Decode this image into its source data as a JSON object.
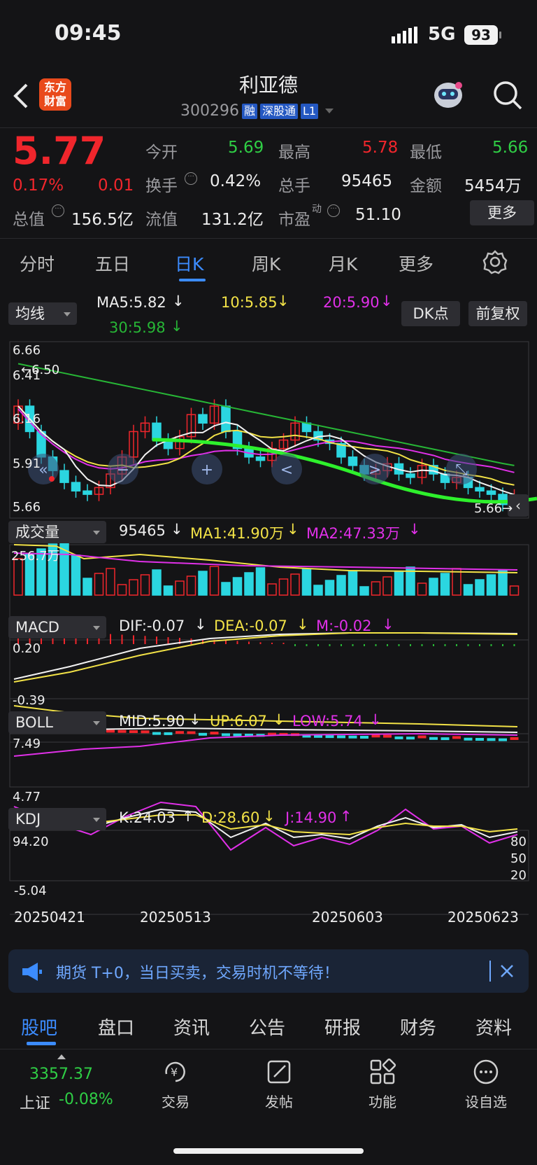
{
  "status": {
    "time": "09:45",
    "network": "5G",
    "battery": "93"
  },
  "header": {
    "title": "利亚德",
    "code": "300296",
    "badges": [
      "融",
      "深股通",
      "L1"
    ]
  },
  "quote": {
    "price": "5.77",
    "pct": "0.17%",
    "change": "0.01",
    "open_label": "今开",
    "open": "5.69",
    "high_label": "最高",
    "high": "5.78",
    "low_label": "最低",
    "low": "5.66",
    "turnover_label": "换手",
    "turnover": "0.42%",
    "volume_label": "总手",
    "volume": "95465",
    "amount_label": "金额",
    "amount": "5454万",
    "mcap_label": "总值",
    "mcap": "156.5亿",
    "float_label": "流值",
    "float": "131.2亿",
    "pe_label": "市盈",
    "pe_sup": "动",
    "pe": "51.10",
    "more": "更多"
  },
  "period_tabs": [
    "分时",
    "五日",
    "日K",
    "周K",
    "月K",
    "更多"
  ],
  "ma": {
    "selector": "均线",
    "ma5": "MA5:5.82",
    "ma10": "10:5.85",
    "ma20": "20:5.90",
    "ma30": "30:5.98",
    "dk": "DK点",
    "adj": "前复权"
  },
  "kline": {
    "y_labels": [
      "6.66",
      "6.41",
      "6.16",
      "5.91",
      "5.66"
    ],
    "high_mark": "6.50",
    "low_mark": "5.66",
    "colors": {
      "up": "#f0262c",
      "down": "#2bd6e0",
      "ma5": "#f2f2f2",
      "ma10": "#f2e247",
      "ma20": "#e030e8",
      "ma30": "#27b636"
    }
  },
  "volume": {
    "selector": "成交量",
    "value": "95465",
    "ma1": "MA1:41.90万",
    "ma2": "MA2:47.33万",
    "max": "256.7万"
  },
  "macd": {
    "selector": "MACD",
    "dif": "DIF:-0.07",
    "dea": "DEA:-0.07",
    "m": "M:-0.02",
    "top": "0.20",
    "bottom": "-0.39"
  },
  "boll": {
    "selector": "BOLL",
    "mid": "MID:5.90",
    "up": "UP:6.07",
    "low": "LOW:5.74",
    "top": "7.49",
    "bottom": "4.77"
  },
  "kdj": {
    "selector": "KDJ",
    "k": "K:24.03",
    "d": "D:28.60",
    "j": "J:14.90",
    "top": "94.20",
    "bottom": "-5.04",
    "r80": "80",
    "r50": "50",
    "r20": "20"
  },
  "dates": [
    "20250421",
    "20250513",
    "20250603",
    "20250623"
  ],
  "banner": {
    "text": "期货 T+0，当日买卖，交易时机不等待！"
  },
  "bottom_tabs": [
    "股吧",
    "盘口",
    "资讯",
    "公告",
    "研报",
    "财务",
    "资料"
  ],
  "footer": {
    "index_value": "3357.37",
    "index_name": "上证",
    "index_change": "-0.08%",
    "nav": [
      {
        "label": "交易",
        "icon": "yen-cycle-icon"
      },
      {
        "label": "发帖",
        "icon": "edit-icon"
      },
      {
        "label": "功能",
        "icon": "grid-icon"
      },
      {
        "label": "设自选",
        "icon": "more-circle-icon"
      }
    ]
  }
}
